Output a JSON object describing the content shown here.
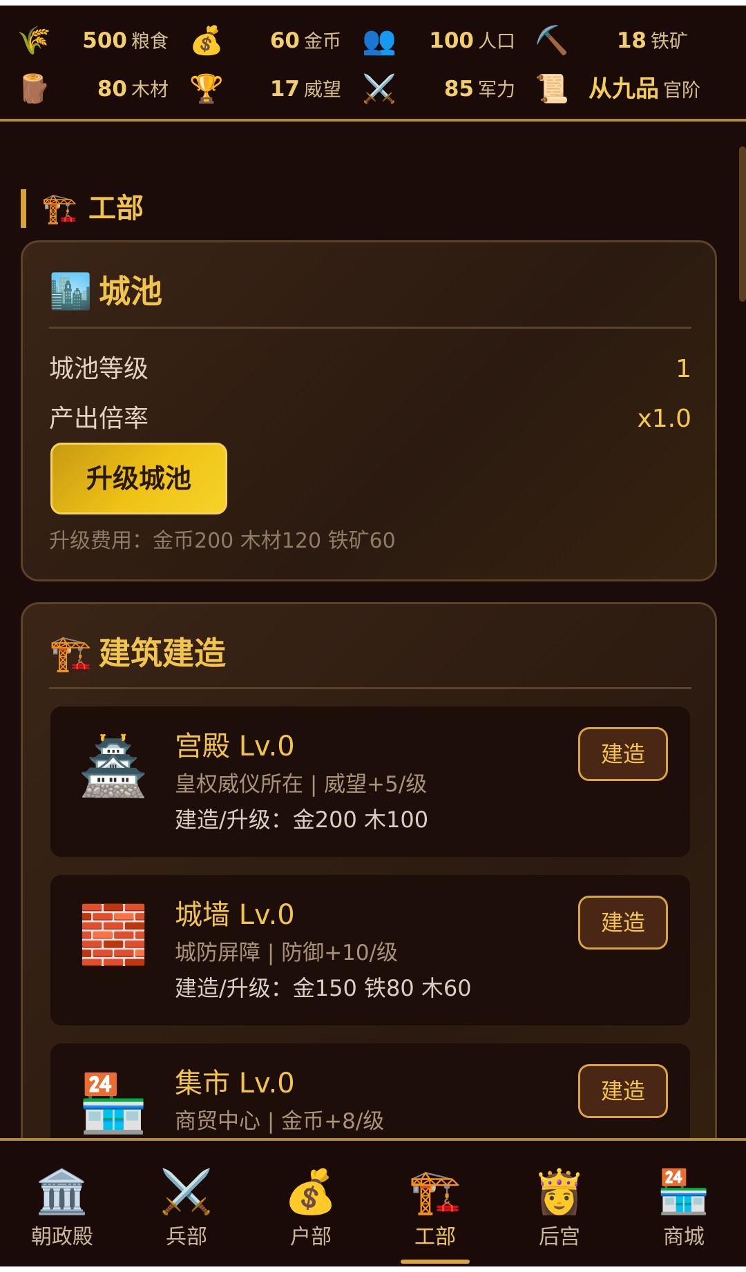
{
  "resources": {
    "row1": [
      {
        "icon": "🌾",
        "value": "500",
        "unit": "粮食"
      },
      {
        "icon": "💰",
        "value": "60",
        "unit": "金币"
      },
      {
        "icon": "👥",
        "value": "100",
        "unit": "人口"
      },
      {
        "icon": "⛏️",
        "value": "18",
        "unit": "铁矿"
      }
    ],
    "row2": [
      {
        "icon": "🪵",
        "value": "80",
        "unit": "木材"
      },
      {
        "icon": "🏆",
        "value": "17",
        "unit": "威望"
      },
      {
        "icon": "⚔️",
        "value": "85",
        "unit": "军力"
      },
      {
        "icon": "📜",
        "value": "从九品",
        "unit": "官阶"
      }
    ]
  },
  "section": {
    "icon": "🏗️",
    "title": "工部"
  },
  "city": {
    "icon": "🏙️",
    "title": "城池",
    "level_label": "城池等级",
    "level_value": "1",
    "rate_label": "产出倍率",
    "rate_value": "x1.0",
    "upgrade_button": "升级城池",
    "upgrade_cost": "升级费用：金币200 木材120 铁矿60"
  },
  "construction": {
    "icon": "🏗️",
    "title": "建筑建造",
    "items": [
      {
        "icon": "🏯",
        "name": "宫殿 Lv.0",
        "desc": "皇权威仪所在 | 威望+5/级",
        "cost": "建造/升级：金200 木100",
        "button": "建造"
      },
      {
        "icon": "🧱",
        "name": "城墙 Lv.0",
        "desc": "城防屏障 | 防御+10/级",
        "cost": "建造/升级：金150 铁80 木60",
        "button": "建造"
      },
      {
        "icon": "🏪",
        "name": "集市 Lv.0",
        "desc": "商贸中心 | 金币+8/级",
        "cost": "",
        "button": "建造"
      }
    ]
  },
  "nav": [
    {
      "icon": "🏛️",
      "label": "朝政殿"
    },
    {
      "icon": "⚔️",
      "label": "兵部"
    },
    {
      "icon": "💰",
      "label": "户部"
    },
    {
      "icon": "🏗️",
      "label": "工部"
    },
    {
      "icon": "👸",
      "label": "后宫"
    },
    {
      "icon": "🏪",
      "label": "商城"
    }
  ],
  "nav_active": "工部",
  "colors": {
    "accent": "#f1c44c",
    "background": "#1b0c09",
    "border": "#b08a3a"
  }
}
